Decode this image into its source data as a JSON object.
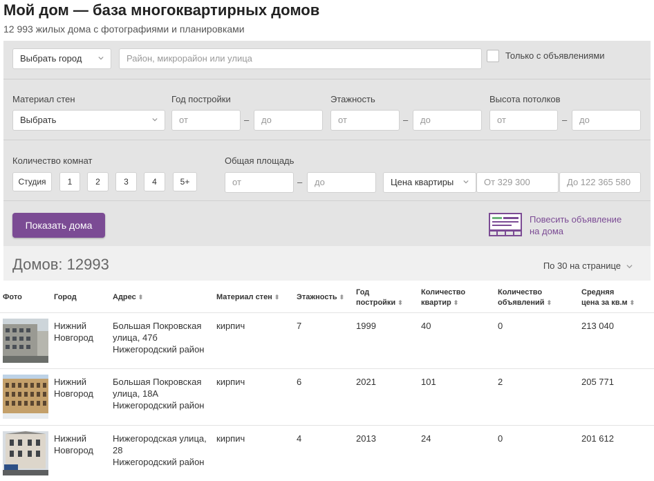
{
  "header": {
    "title": "Мой дом — база многоквартирных домов",
    "subtitle": "12 993 жилых дома с фотографиями и планировками"
  },
  "filters": {
    "city_select": "Выбрать город",
    "search_placeholder": "Район, микрорайон или улица",
    "only_ads_label": "Только с объявлениями",
    "wall_material": {
      "label": "Материал стен",
      "value": "Выбрать"
    },
    "build_year": {
      "label": "Год постройки",
      "from": "от",
      "to": "до"
    },
    "floors": {
      "label": "Этажность",
      "from": "от",
      "to": "до"
    },
    "ceiling_height": {
      "label": "Высота потолков",
      "from": "от",
      "to": "до"
    },
    "rooms": {
      "label": "Количество комнат",
      "options": [
        "Студия",
        "1",
        "2",
        "3",
        "4",
        "5+"
      ]
    },
    "area": {
      "label": "Общая площадь",
      "from": "от",
      "to": "до"
    },
    "price": {
      "select": "Цена квартиры",
      "from": "От 329 300",
      "to": "До 122 365 580"
    },
    "show_button": "Показать дома",
    "post_ad": "Повесить объявление на дома"
  },
  "summary": {
    "count_label": "Домов: 12993",
    "per_page": "По 30 на странице"
  },
  "table": {
    "headers": {
      "photo": "Фото",
      "city": "Город",
      "address": "Адрес",
      "material": "Материал стен",
      "floors": "Этажность",
      "year_l1": "Год",
      "year_l2": "постройки",
      "flats_l1": "Количество",
      "flats_l2": "квартир",
      "ads_l1": "Количество",
      "ads_l2": "объявлений",
      "price_l1": "Средняя",
      "price_l2": "цена за кв.м"
    },
    "sort_icon": "⬍",
    "rows": [
      {
        "city_l1": "Нижний",
        "city_l2": "Новгород",
        "addr_l1": "Большая Покровская",
        "addr_l2": "улица, 47б",
        "district": "Нижегородский район",
        "material": "кирпич",
        "floors": "7",
        "year": "1999",
        "flats": "40",
        "ads": "0",
        "price": "213 040"
      },
      {
        "city_l1": "Нижний",
        "city_l2": "Новгород",
        "addr_l1": "Большая Покровская",
        "addr_l2": "улица, 18А",
        "district": "Нижегородский район",
        "material": "кирпич",
        "floors": "6",
        "year": "2021",
        "flats": "101",
        "ads": "2",
        "price": "205 771"
      },
      {
        "city_l1": "Нижний",
        "city_l2": "Новгород",
        "addr_l1": "Нижегородская улица,",
        "addr_l2": "28",
        "district": "Нижегородский район",
        "material": "кирпич",
        "floors": "4",
        "year": "2013",
        "flats": "24",
        "ads": "0",
        "price": "201 612"
      }
    ]
  },
  "colors": {
    "accent": "#7b4b94",
    "filter_bg": "#e4e4e4"
  }
}
